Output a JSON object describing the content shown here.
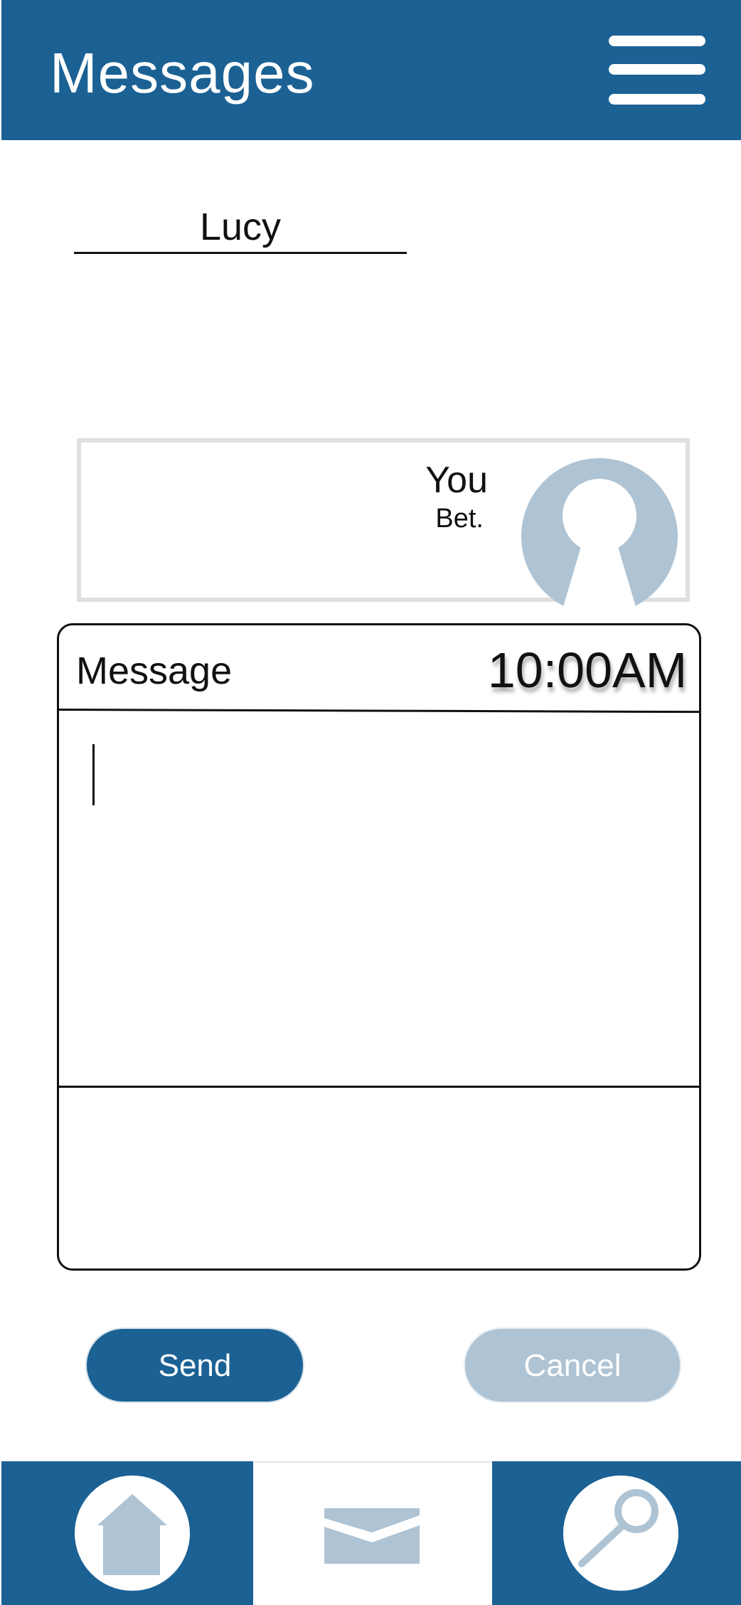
{
  "header": {
    "title": "Messages",
    "menu_icon": "hamburger-menu-icon"
  },
  "recipient": {
    "name": "Lucy"
  },
  "preview": {
    "sender": "You",
    "body": "Bet.",
    "avatar_icon": "user-avatar-icon"
  },
  "compose": {
    "label": "Message",
    "time": "10:00AM",
    "value": ""
  },
  "actions": {
    "send_label": "Send",
    "cancel_label": "Cancel"
  },
  "nav": {
    "items": [
      {
        "icon": "home-icon",
        "active": false
      },
      {
        "icon": "mail-icon",
        "active": true
      },
      {
        "icon": "search-icon",
        "active": false
      }
    ]
  },
  "colors": {
    "primary": "#1b6194",
    "muted": "#aec3d3",
    "border": "#e0e0e0",
    "text": "#111111"
  }
}
